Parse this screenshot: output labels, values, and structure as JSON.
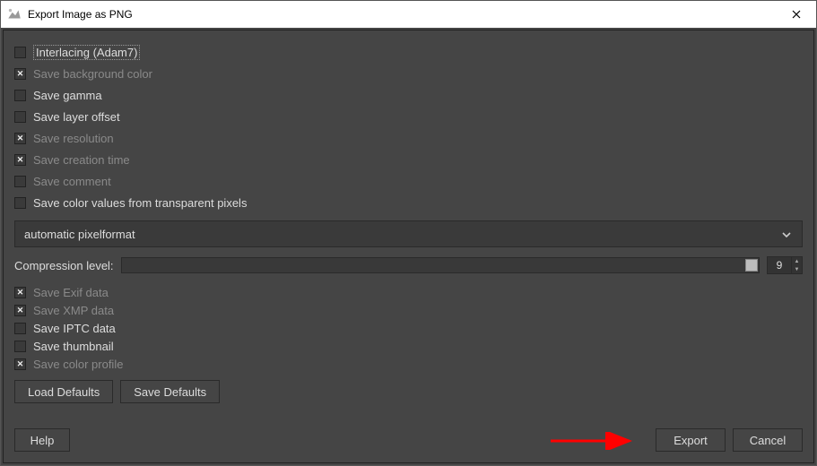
{
  "window": {
    "title": "Export Image as PNG"
  },
  "options": {
    "interlacing": {
      "label": "Interlacing (Adam7)",
      "checked": false,
      "dim": false,
      "focus": true
    },
    "save_bg": {
      "label": "Save background color",
      "checked": true,
      "dim": true
    },
    "save_gamma": {
      "label": "Save gamma",
      "checked": false,
      "dim": false
    },
    "save_layer_off": {
      "label": "Save layer offset",
      "checked": false,
      "dim": false
    },
    "save_res": {
      "label": "Save resolution",
      "checked": true,
      "dim": true
    },
    "save_ctime": {
      "label": "Save creation time",
      "checked": true,
      "dim": true
    },
    "save_comment": {
      "label": "Save comment",
      "checked": false,
      "dim": true
    },
    "save_transp": {
      "label": "Save color values from transparent pixels",
      "checked": false,
      "dim": false
    }
  },
  "pixelformat": {
    "value": "automatic pixelformat"
  },
  "compression": {
    "label": "Compression level:",
    "value": "9"
  },
  "meta": {
    "exif": {
      "label": "Save Exif data",
      "checked": true,
      "dim": true
    },
    "xmp": {
      "label": "Save XMP data",
      "checked": true,
      "dim": true
    },
    "iptc": {
      "label": "Save IPTC data",
      "checked": false,
      "dim": false
    },
    "thumb": {
      "label": "Save thumbnail",
      "checked": false,
      "dim": false
    },
    "colorprof": {
      "label": "Save color profile",
      "checked": true,
      "dim": true
    }
  },
  "buttons": {
    "load_defaults": "Load Defaults",
    "save_defaults": "Save Defaults",
    "help": "Help",
    "export": "Export",
    "cancel": "Cancel"
  }
}
